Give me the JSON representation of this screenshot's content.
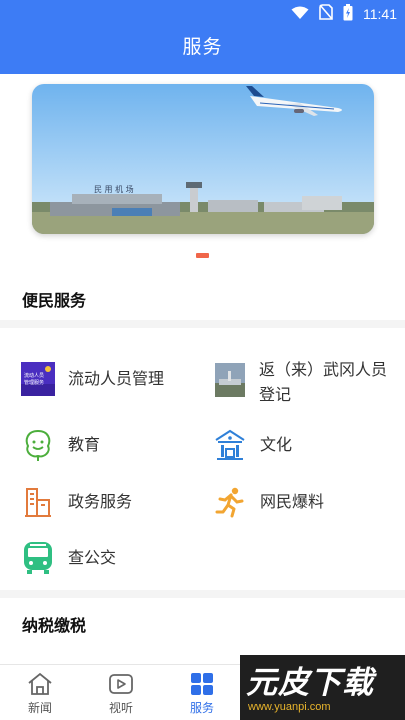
{
  "status_bar": {
    "time": "11:41"
  },
  "header": {
    "title": "服务"
  },
  "banner": {
    "sign_text": "民 用 机 场"
  },
  "sections": [
    {
      "title": "便民服务",
      "items": [
        {
          "label": "流动人员管理",
          "icon": "floating-population-icon",
          "thumb_text": "流动人员管理服务系统"
        },
        {
          "label": "返（来）武冈人员登记",
          "label_line1": "返（来）武冈人员",
          "label_line2": "登记",
          "icon": "airport-photo-icon"
        },
        {
          "label": "教育",
          "icon": "education-icon"
        },
        {
          "label": "文化",
          "icon": "culture-icon"
        },
        {
          "label": "政务服务",
          "icon": "government-service-icon"
        },
        {
          "label": "网民爆料",
          "icon": "runner-icon"
        },
        {
          "label": "查公交",
          "icon": "bus-icon"
        }
      ]
    },
    {
      "title": "纳税缴税"
    }
  ],
  "nav": {
    "items": [
      {
        "label": "新闻",
        "icon": "home-icon"
      },
      {
        "label": "视听",
        "icon": "play-icon"
      },
      {
        "label": "服务",
        "icon": "grid-icon",
        "active": true
      }
    ]
  },
  "watermark": {
    "title": "元皮下载",
    "url": "www.yuanpi.com"
  },
  "colors": {
    "header": "#3d7cf5",
    "active": "#2f6fe8",
    "indicator": "#f0664a",
    "watermark_accent": "#e9b52c"
  }
}
